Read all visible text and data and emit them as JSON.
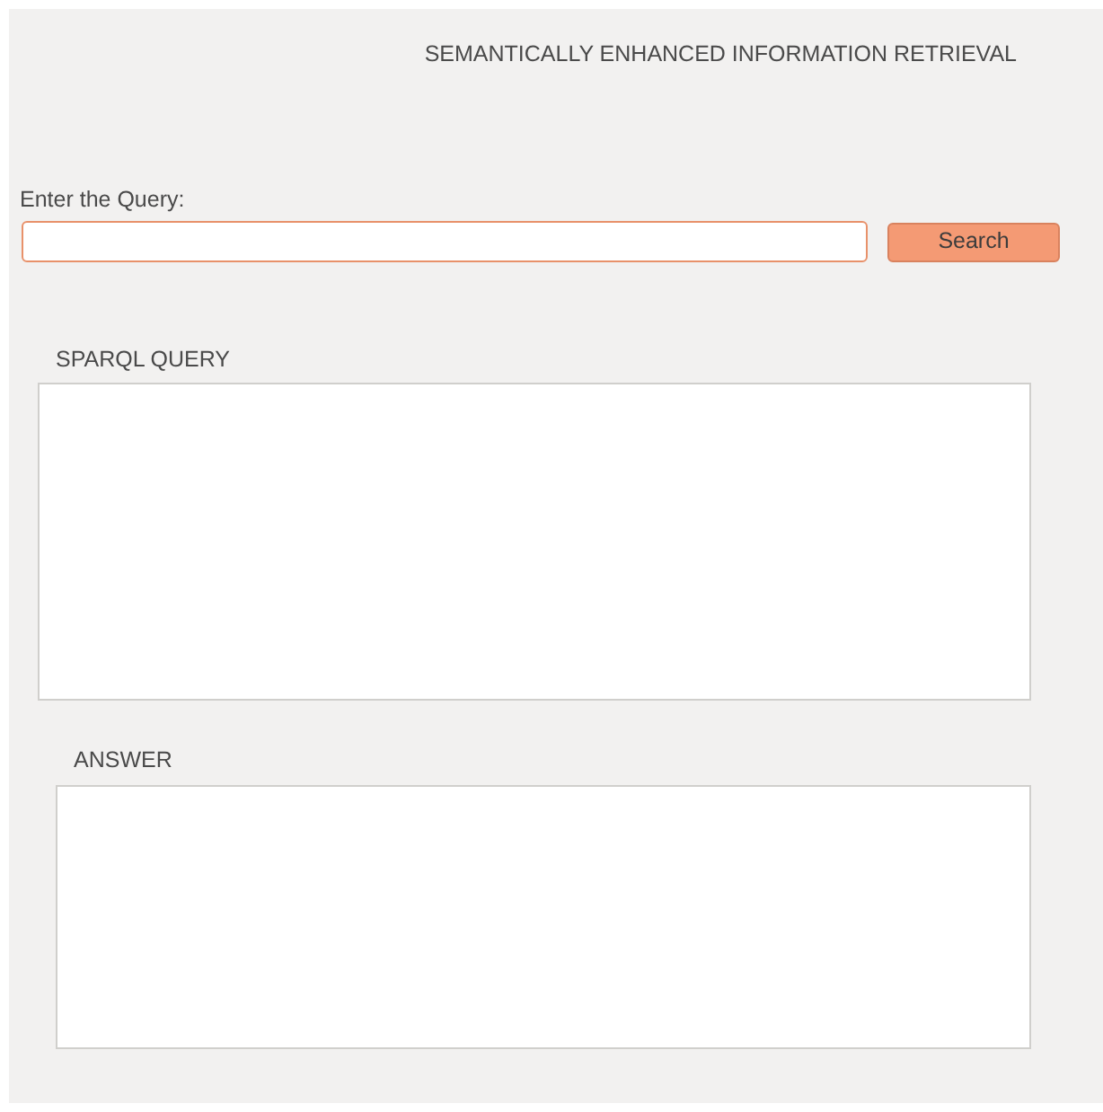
{
  "window": {
    "title": "SEMANTICALLY ENHANCED INFORMATION RETRIEVAL"
  },
  "query": {
    "label": "Enter the Query:",
    "focused": true
  },
  "search_button": {
    "label": "Search"
  },
  "sparql": {
    "label": "SPARQL QUERY"
  },
  "answer": {
    "label": "ANSWER"
  }
}
